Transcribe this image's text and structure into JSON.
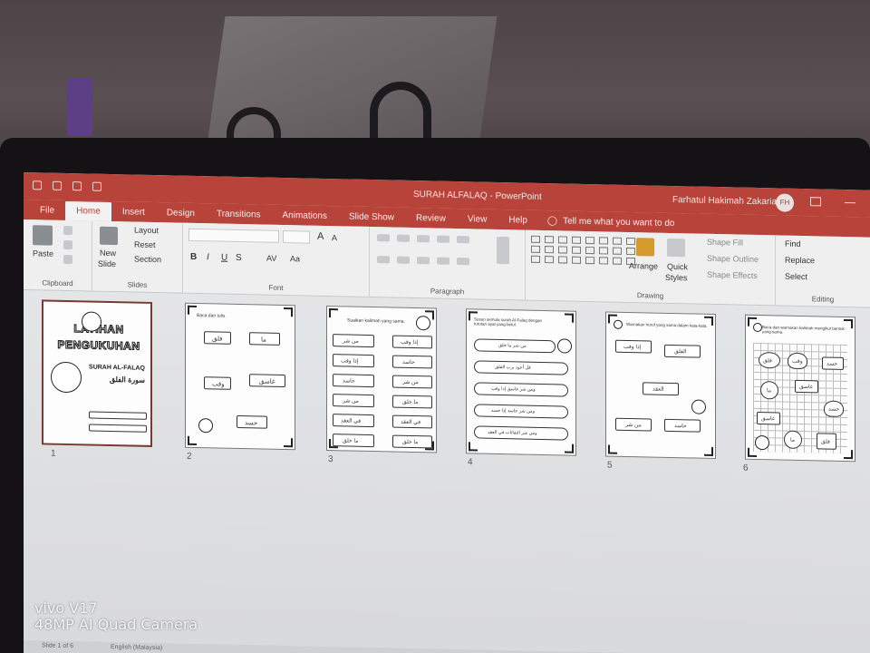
{
  "app": {
    "doc_title": "SURAH ALFALAQ",
    "app_name": "PowerPoint",
    "title_sep": "-",
    "user_name": "Farhatul Hakimah Zakaria",
    "user_initials": "FH"
  },
  "tabs": [
    "File",
    "Home",
    "Insert",
    "Design",
    "Transitions",
    "Animations",
    "Slide Show",
    "Review",
    "View",
    "Help"
  ],
  "active_tab": "Home",
  "tell_me": "Tell me what you want to do",
  "ribbon": {
    "clipboard": {
      "paste": "Paste",
      "label": "Clipboard"
    },
    "slides": {
      "new_slide": "New",
      "new_slide2": "Slide",
      "layout": "Layout",
      "reset": "Reset",
      "section": "Section",
      "label": "Slides"
    },
    "font": {
      "label": "Font",
      "bold": "B",
      "italic": "I",
      "underline": "U",
      "strike": "S",
      "aa": "Aa",
      "grow": "A",
      "shrink": "A",
      "av": "AV"
    },
    "paragraph": {
      "label": "Paragraph"
    },
    "drawing": {
      "arrange": "Arrange",
      "quick_styles": "Quick",
      "quick_styles2": "Styles",
      "fill": "Shape Fill",
      "outline": "Shape Outline",
      "effects": "Shape Effects",
      "label": "Drawing"
    },
    "editing": {
      "find": "Find",
      "replace": "Replace",
      "select": "Select",
      "label": "Editing"
    }
  },
  "slides": [
    {
      "num": "1",
      "title_line1": "LATIHAN",
      "title_line2": "PENGUKUHAN",
      "sub1": "SURAH AL-FALAQ",
      "sub2": "سورة الفلق"
    },
    {
      "num": "2",
      "header": "Baca dan tulis",
      "words": [
        "فلق",
        "ما",
        "وقب",
        "غاسق",
        "حسد"
      ]
    },
    {
      "num": "3",
      "header": "Suaikan kalimah yang sama.",
      "left": [
        "من شر",
        "إذا وقب",
        "حاسد",
        "من شر",
        "في العقد",
        "ما خلق"
      ],
      "right": [
        "إذا وقب",
        "حاسد",
        "من شر",
        "ما خلق",
        "في العقد",
        "ما خلق"
      ]
    },
    {
      "num": "4",
      "header": "Susun semula surah Al-Falaq dengan turutan ayat yang betul.",
      "lines": [
        "من شر ما خلق",
        "قل أعوذ برب الفلق",
        "ومن شر غاسق إذا وقب",
        "ومن شر حاسد إذا حسد",
        "ومن شر النفاثات في العقد"
      ]
    },
    {
      "num": "5",
      "header": "Warnakan huruf yang sama dalam kata-kata.",
      "words": [
        "إذا وقب",
        "الفلق",
        "العقد",
        "من شر",
        "حاسد"
      ]
    },
    {
      "num": "6",
      "header": "Baca dan warnakan kalimah mengikut bentuk yang sama.",
      "words": [
        "وقب",
        "حسد",
        "فلق",
        "غاسق",
        "ما",
        "حسد",
        "غاسق",
        "ما",
        "فلق"
      ]
    }
  ],
  "status": {
    "slide_info": "Slide 1 of 6",
    "lang": "English (Malaysia)"
  },
  "watermark": {
    "line1": "vivo V17",
    "line2": "48MP AI Quad Camera"
  }
}
